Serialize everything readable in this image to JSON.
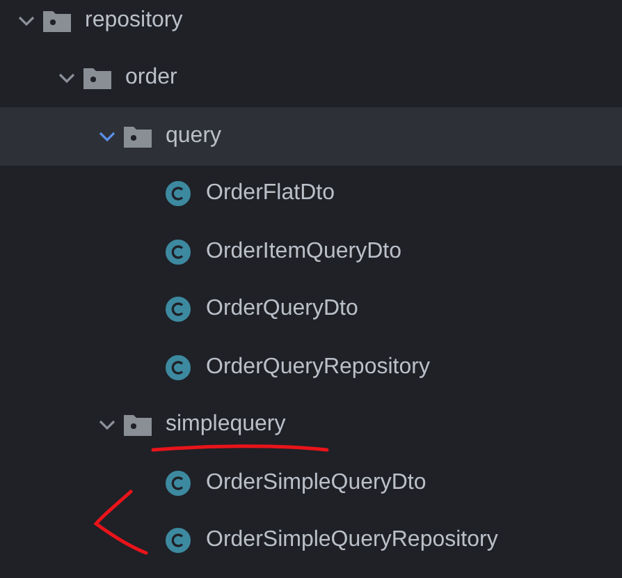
{
  "tree": [
    {
      "kind": "package",
      "label": "repository",
      "expanded": true,
      "selected": false,
      "children": [
        {
          "kind": "package",
          "label": "order",
          "expanded": true,
          "selected": false,
          "children": [
            {
              "kind": "package",
              "label": "query",
              "expanded": true,
              "selected": true,
              "children": [
                {
                  "kind": "class",
                  "label": "OrderFlatDto",
                  "selected": false
                },
                {
                  "kind": "class",
                  "label": "OrderItemQueryDto",
                  "selected": false
                },
                {
                  "kind": "class",
                  "label": "OrderQueryDto",
                  "selected": false
                },
                {
                  "kind": "class",
                  "label": "OrderQueryRepository",
                  "selected": false
                }
              ]
            },
            {
              "kind": "package",
              "label": "simplequery",
              "expanded": true,
              "selected": false,
              "children": [
                {
                  "kind": "class",
                  "label": "OrderSimpleQueryDto",
                  "selected": false
                },
                {
                  "kind": "class",
                  "label": "OrderSimpleQueryRepository",
                  "selected": false
                }
              ]
            }
          ]
        }
      ]
    }
  ]
}
